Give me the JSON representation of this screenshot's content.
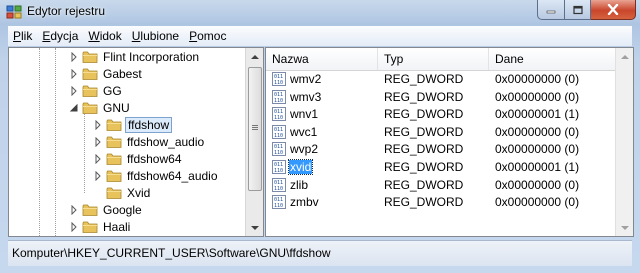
{
  "window": {
    "title": "Edytor rejestru"
  },
  "menu": [
    {
      "label": "Plik",
      "u": "P",
      "rest": "lik"
    },
    {
      "label": "Edycja",
      "u": "E",
      "rest": "dycja"
    },
    {
      "label": "Widok",
      "u": "W",
      "rest": "idok"
    },
    {
      "label": "Ulubione",
      "u": "U",
      "rest": "lubione"
    },
    {
      "label": "Pomoc",
      "u": "P",
      "rest": "omoc"
    }
  ],
  "tree": {
    "items": [
      {
        "label": "Flint Incorporation",
        "expander": "collapsed"
      },
      {
        "label": "Gabest",
        "expander": "collapsed"
      },
      {
        "label": "GG",
        "expander": "collapsed"
      },
      {
        "label": "GNU",
        "expander": "expanded"
      },
      {
        "label": "ffdshow",
        "expander": "collapsed",
        "selected": true
      },
      {
        "label": "ffdshow_audio",
        "expander": "collapsed"
      },
      {
        "label": "ffdshow64",
        "expander": "collapsed"
      },
      {
        "label": "ffdshow64_audio",
        "expander": "collapsed"
      },
      {
        "label": "Xvid",
        "expander": "none"
      },
      {
        "label": "Google",
        "expander": "collapsed"
      },
      {
        "label": "Haali",
        "expander": "collapsed"
      }
    ]
  },
  "list": {
    "columns": [
      "Nazwa",
      "Typ",
      "Dane"
    ],
    "rows": [
      {
        "name": "wmv2",
        "type": "REG_DWORD",
        "data": "0x00000000 (0)"
      },
      {
        "name": "wmv3",
        "type": "REG_DWORD",
        "data": "0x00000000 (0)"
      },
      {
        "name": "wnv1",
        "type": "REG_DWORD",
        "data": "0x00000001 (1)"
      },
      {
        "name": "wvc1",
        "type": "REG_DWORD",
        "data": "0x00000000 (0)"
      },
      {
        "name": "wvp2",
        "type": "REG_DWORD",
        "data": "0x00000000 (0)"
      },
      {
        "name": "xvid",
        "type": "REG_DWORD",
        "data": "0x00000001 (1)",
        "selected": true
      },
      {
        "name": "zlib",
        "type": "REG_DWORD",
        "data": "0x00000000 (0)"
      },
      {
        "name": "zmbv",
        "type": "REG_DWORD",
        "data": "0x00000000 (0)"
      }
    ]
  },
  "status": {
    "path": "Komputer\\HKEY_CURRENT_USER\\Software\\GNU\\ffdshow"
  },
  "colors": {
    "folder": "#e8c25a",
    "selection": "#3399ff",
    "close_button": "#c9462c"
  },
  "icons": {
    "app": "registry-editor-icon",
    "folder": "folder-icon",
    "value": "reg-dword-icon"
  }
}
